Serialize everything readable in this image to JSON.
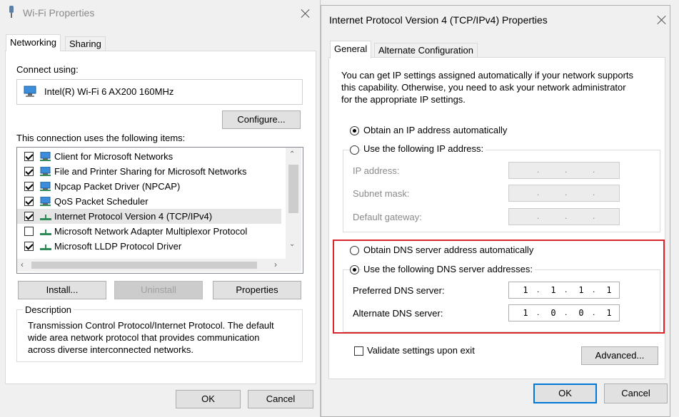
{
  "wifi_dialog": {
    "title": "Wi-Fi Properties",
    "tabs": [
      "Networking",
      "Sharing"
    ],
    "connect_using_label": "Connect using:",
    "adapter_name": "Intel(R) Wi-Fi 6 AX200 160MHz",
    "configure_button": "Configure...",
    "items_label": "This connection uses the following items:",
    "items": [
      {
        "label": "Client for Microsoft Networks",
        "checked": true
      },
      {
        "label": "File and Printer Sharing for Microsoft Networks",
        "checked": true
      },
      {
        "label": "Npcap Packet Driver (NPCAP)",
        "checked": true
      },
      {
        "label": "QoS Packet Scheduler",
        "checked": true
      },
      {
        "label": "Internet Protocol Version 4 (TCP/IPv4)",
        "checked": true
      },
      {
        "label": "Microsoft Network Adapter Multiplexor Protocol",
        "checked": false
      },
      {
        "label": "Microsoft LLDP Protocol Driver",
        "checked": true
      }
    ],
    "install_button": "Install...",
    "uninstall_button": "Uninstall",
    "properties_button": "Properties",
    "description_label": "Description",
    "description_lines": [
      "Transmission Control Protocol/Internet Protocol. The default",
      "wide area network protocol that provides communication",
      "across diverse interconnected networks."
    ],
    "ok_button": "OK",
    "cancel_button": "Cancel"
  },
  "ipv4_dialog": {
    "title": "Internet Protocol Version 4 (TCP/IPv4) Properties",
    "tabs": [
      "General",
      "Alternate Configuration"
    ],
    "intro_lines": [
      "You can get IP settings assigned automatically if your network supports",
      "this capability. Otherwise, you need to ask your network administrator",
      "for the appropriate IP settings."
    ],
    "obtain_ip_auto": "Obtain an IP address automatically",
    "use_following_ip": "Use the following IP address:",
    "ip_address_label": "IP address:",
    "subnet_mask_label": "Subnet mask:",
    "default_gateway_label": "Default gateway:",
    "obtain_dns_auto": "Obtain DNS server address automatically",
    "use_following_dns": "Use the following DNS server addresses:",
    "preferred_dns_label": "Preferred DNS server:",
    "preferred_dns": [
      "1",
      "1",
      "1",
      "1"
    ],
    "alternate_dns_label": "Alternate DNS server:",
    "alternate_dns": [
      "1",
      "0",
      "0",
      "1"
    ],
    "validate_label": "Validate settings upon exit",
    "advanced_button": "Advanced...",
    "ok_button": "OK",
    "cancel_button": "Cancel",
    "highlight_color": "#d9262c"
  }
}
